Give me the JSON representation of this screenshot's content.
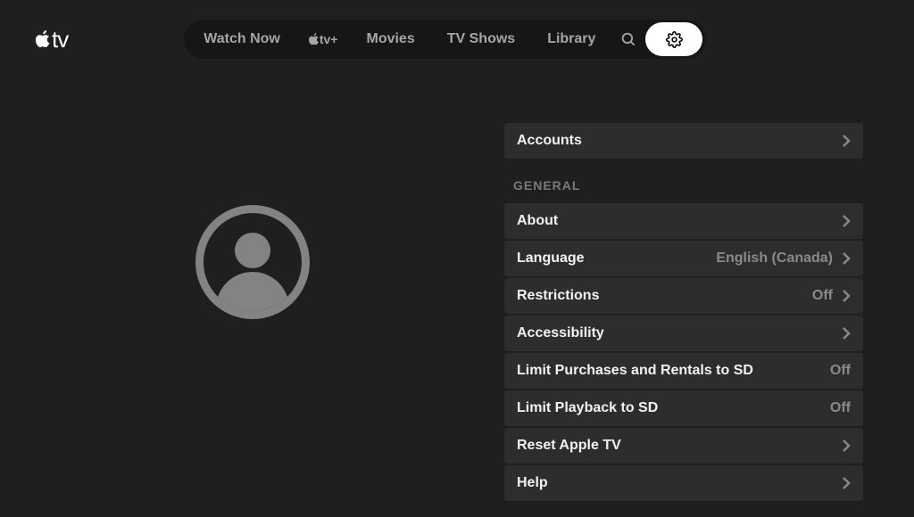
{
  "logo_text": "tv",
  "nav": {
    "watch_now": "Watch Now",
    "tvplus": "tv+",
    "movies": "Movies",
    "tvshows": "TV Shows",
    "library": "Library"
  },
  "settings": {
    "accounts_label": "Accounts",
    "general_header": "GENERAL",
    "items": {
      "about": {
        "label": "About"
      },
      "language": {
        "label": "Language",
        "value": "English (Canada)"
      },
      "restrictions": {
        "label": "Restrictions",
        "value": "Off"
      },
      "accessibility": {
        "label": "Accessibility"
      },
      "limit_purchases": {
        "label": "Limit Purchases and Rentals to SD",
        "value": "Off"
      },
      "limit_playback": {
        "label": "Limit Playback to SD",
        "value": "Off"
      },
      "reset": {
        "label": "Reset Apple TV"
      },
      "help": {
        "label": "Help"
      }
    }
  }
}
